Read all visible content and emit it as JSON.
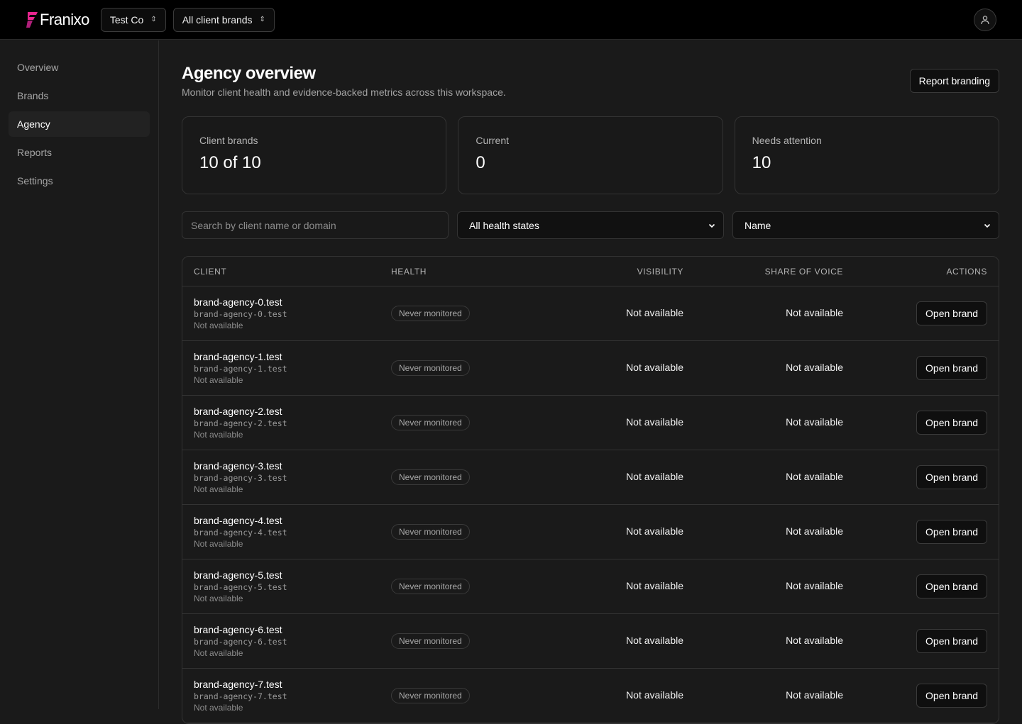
{
  "header": {
    "logo_text": "Franixo",
    "brand_color": "#e8258f",
    "workspace": "Test Co",
    "brand_filter": "All client brands"
  },
  "sidebar": {
    "items": [
      {
        "label": "Overview",
        "active": false
      },
      {
        "label": "Brands",
        "active": false
      },
      {
        "label": "Agency",
        "active": true
      },
      {
        "label": "Reports",
        "active": false
      },
      {
        "label": "Settings",
        "active": false
      }
    ]
  },
  "page": {
    "title": "Agency overview",
    "subtitle": "Monitor client health and evidence-backed metrics across this workspace.",
    "report_branding_label": "Report branding"
  },
  "stats": [
    {
      "label": "Client brands",
      "value": "10 of 10"
    },
    {
      "label": "Current",
      "value": "0"
    },
    {
      "label": "Needs attention",
      "value": "10"
    }
  ],
  "filters": {
    "search_placeholder": "Search by client name or domain",
    "health_value": "All health states",
    "sort_value": "Name"
  },
  "table": {
    "columns": [
      "CLIENT",
      "HEALTH",
      "VISIBILITY",
      "SHARE OF VOICE",
      "ACTIONS"
    ],
    "rows": [
      {
        "name": "brand-agency-0.test",
        "domain": "brand-agency-0.test",
        "note": "Not available",
        "health": "Never monitored",
        "visibility": "Not available",
        "sov": "Not available",
        "action": "Open brand"
      },
      {
        "name": "brand-agency-1.test",
        "domain": "brand-agency-1.test",
        "note": "Not available",
        "health": "Never monitored",
        "visibility": "Not available",
        "sov": "Not available",
        "action": "Open brand"
      },
      {
        "name": "brand-agency-2.test",
        "domain": "brand-agency-2.test",
        "note": "Not available",
        "health": "Never monitored",
        "visibility": "Not available",
        "sov": "Not available",
        "action": "Open brand"
      },
      {
        "name": "brand-agency-3.test",
        "domain": "brand-agency-3.test",
        "note": "Not available",
        "health": "Never monitored",
        "visibility": "Not available",
        "sov": "Not available",
        "action": "Open brand"
      },
      {
        "name": "brand-agency-4.test",
        "domain": "brand-agency-4.test",
        "note": "Not available",
        "health": "Never monitored",
        "visibility": "Not available",
        "sov": "Not available",
        "action": "Open brand"
      },
      {
        "name": "brand-agency-5.test",
        "domain": "brand-agency-5.test",
        "note": "Not available",
        "health": "Never monitored",
        "visibility": "Not available",
        "sov": "Not available",
        "action": "Open brand"
      },
      {
        "name": "brand-agency-6.test",
        "domain": "brand-agency-6.test",
        "note": "Not available",
        "health": "Never monitored",
        "visibility": "Not available",
        "sov": "Not available",
        "action": "Open brand"
      },
      {
        "name": "brand-agency-7.test",
        "domain": "brand-agency-7.test",
        "note": "Not available",
        "health": "Never monitored",
        "visibility": "Not available",
        "sov": "Not available",
        "action": "Open brand"
      }
    ]
  }
}
